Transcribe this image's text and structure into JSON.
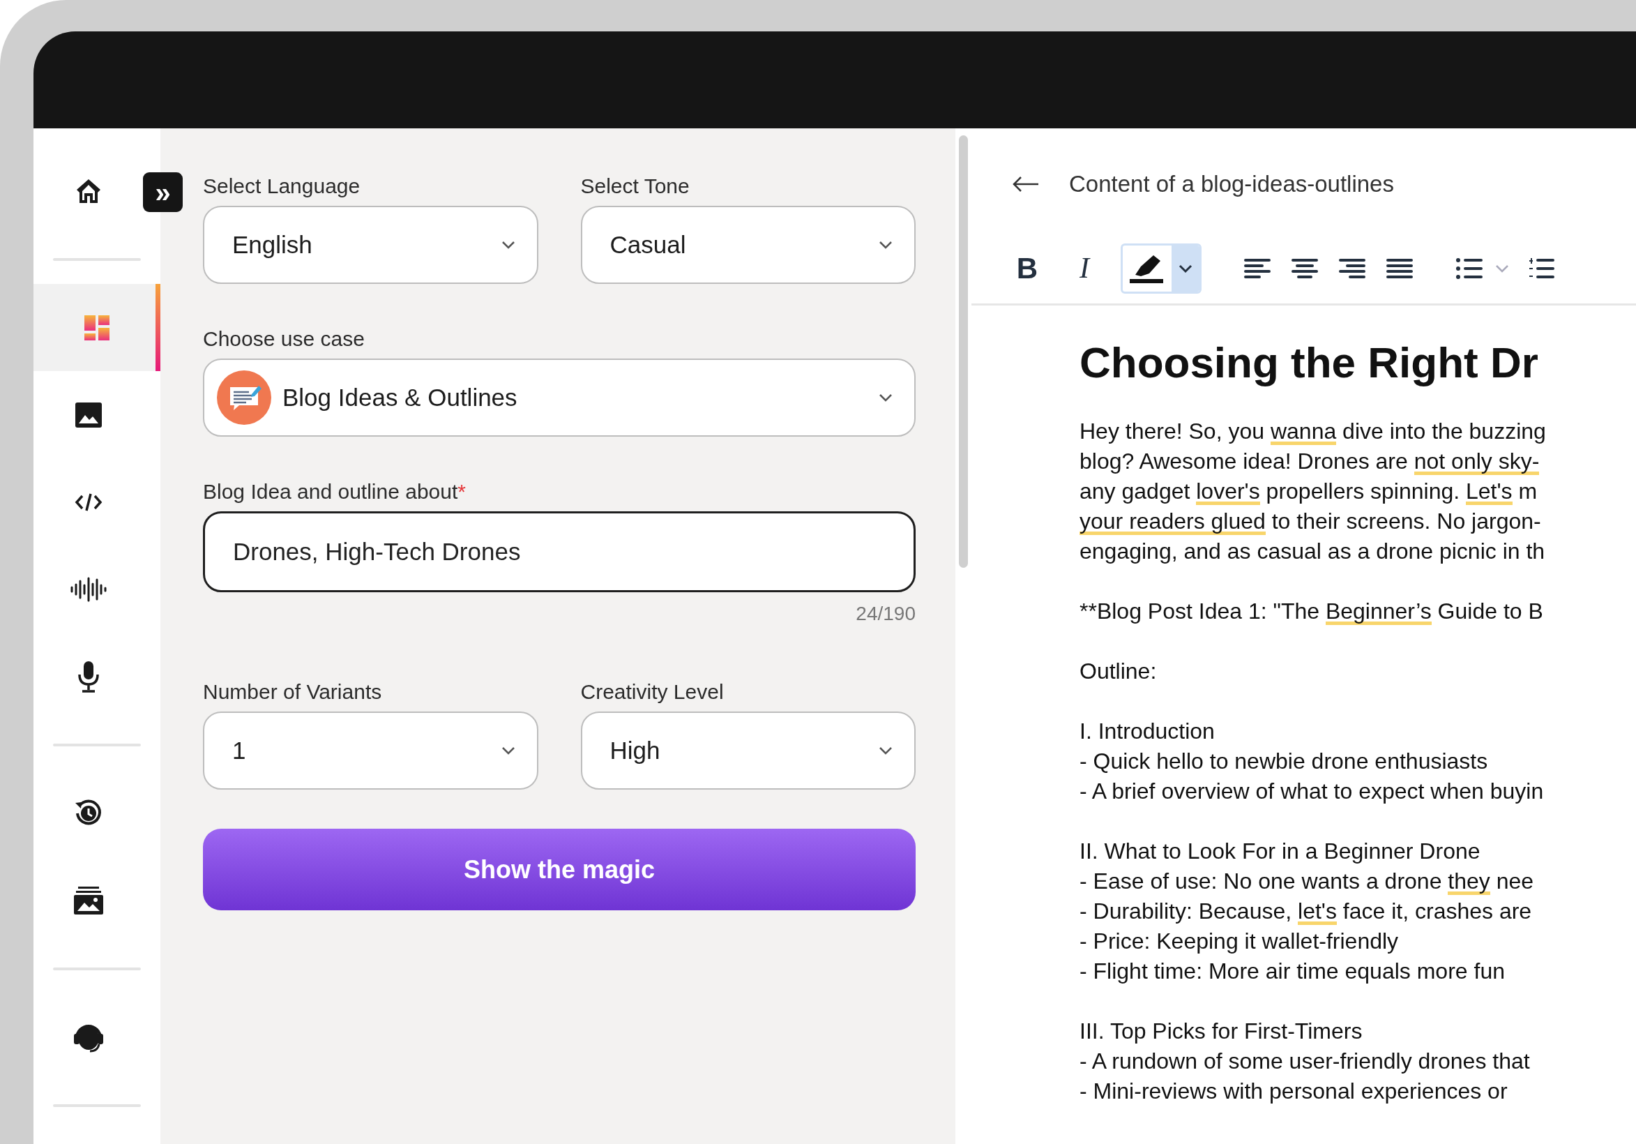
{
  "sidebar": {
    "collapse": {
      "label": "»"
    },
    "groups": [
      {
        "items": [
          {
            "kind": "home",
            "selected": false
          }
        ]
      },
      {
        "items": [
          {
            "kind": "templates",
            "selected": true
          },
          {
            "kind": "image",
            "selected": false
          },
          {
            "kind": "code",
            "selected": false
          },
          {
            "kind": "audio",
            "selected": false
          },
          {
            "kind": "mic",
            "selected": false
          }
        ]
      },
      {
        "items": [
          {
            "kind": "history",
            "selected": false
          },
          {
            "kind": "gallery",
            "selected": false
          }
        ]
      },
      {
        "items": [
          {
            "kind": "support",
            "selected": false
          }
        ]
      }
    ]
  },
  "form": {
    "language": {
      "label": "Select Language",
      "value": "English"
    },
    "tone": {
      "label": "Select Tone",
      "value": "Casual"
    },
    "use_case": {
      "label": "Choose use case",
      "value": "Blog Ideas & Outlines"
    },
    "topic": {
      "label": "Blog Idea and outline about",
      "required_mark": "*",
      "value": "Drones, High-Tech Drones",
      "counter": "24/190"
    },
    "variants": {
      "label": "Number of Variants",
      "value": "1"
    },
    "creativity": {
      "label": "Creativity Level",
      "value": "High"
    },
    "submit": "Show the magic"
  },
  "editor": {
    "title": "Content of a blog-ideas-outlines",
    "toolbar": [
      {
        "kind": "bold",
        "label": "B",
        "active": false
      },
      {
        "kind": "italic",
        "label": "I",
        "active": false
      },
      {
        "kind": "highlight",
        "active": true
      },
      {
        "kind": "align-left",
        "active": false
      },
      {
        "kind": "align-center",
        "active": false
      },
      {
        "kind": "align-right",
        "active": false
      },
      {
        "kind": "justify",
        "active": false
      },
      {
        "kind": "bullet-list",
        "active": false
      },
      {
        "kind": "numbered-list",
        "active": false
      }
    ],
    "heading": "Choosing the Right Dr",
    "paragraphs": [
      {
        "lines": [
          [
            {
              "text": "Hey there! So, you ",
              "flagged": false
            },
            {
              "text": "wanna",
              "flagged": true
            },
            {
              "text": " dive into the buzzing",
              "flagged": false
            }
          ],
          [
            {
              "text": "blog? Awesome idea! Drones are ",
              "flagged": false
            },
            {
              "text": "not only sky-",
              "flagged": true
            }
          ],
          [
            {
              "text": "any gadget ",
              "flagged": false
            },
            {
              "text": "lover's",
              "flagged": true
            },
            {
              "text": " propellers spinning. ",
              "flagged": false
            },
            {
              "text": "Let's",
              "flagged": true
            },
            {
              "text": " m",
              "flagged": false
            }
          ],
          [
            {
              "text": "your readers glued",
              "flagged": true
            },
            {
              "text": " to their screens. No jargon-",
              "flagged": false
            }
          ],
          [
            {
              "text": "engaging, and as casual as a drone picnic in th",
              "flagged": false
            }
          ]
        ]
      },
      {
        "lines": [
          [
            {
              "text": "**Blog Post Idea 1: \"The ",
              "flagged": false
            },
            {
              "text": "Beginner’s",
              "flagged": true
            },
            {
              "text": " Guide to B",
              "flagged": false
            }
          ]
        ]
      },
      {
        "lines": [
          [
            {
              "text": "Outline:",
              "flagged": false
            }
          ]
        ]
      },
      {
        "lines": [
          [
            {
              "text": "I. Introduction",
              "flagged": false
            }
          ],
          [
            {
              "text": "- Quick hello to newbie drone enthusiasts",
              "flagged": false
            }
          ],
          [
            {
              "text": "- A brief overview of what to expect when buyin",
              "flagged": false
            }
          ]
        ]
      },
      {
        "lines": [
          [
            {
              "text": "II. What to Look For in a Beginner Drone",
              "flagged": false
            }
          ],
          [
            {
              "text": "- Ease of use: No one wants a drone ",
              "flagged": false
            },
            {
              "text": "they",
              "flagged": true
            },
            {
              "text": " nee",
              "flagged": false
            }
          ],
          [
            {
              "text": "- Durability: Because, ",
              "flagged": false
            },
            {
              "text": "let's",
              "flagged": true
            },
            {
              "text": " face it, crashes are",
              "flagged": false
            }
          ],
          [
            {
              "text": "- Price: Keeping it wallet-friendly",
              "flagged": false
            }
          ],
          [
            {
              "text": "- Flight time: More air time equals more fun",
              "flagged": false
            }
          ]
        ]
      },
      {
        "lines": [
          [
            {
              "text": "III. Top Picks for First-Timers",
              "flagged": false
            }
          ],
          [
            {
              "text": "- A rundown of some user-friendly drones that",
              "flagged": false
            }
          ],
          [
            {
              "text": "- Mini-reviews with personal experiences or",
              "flagged": false
            }
          ]
        ]
      }
    ]
  }
}
